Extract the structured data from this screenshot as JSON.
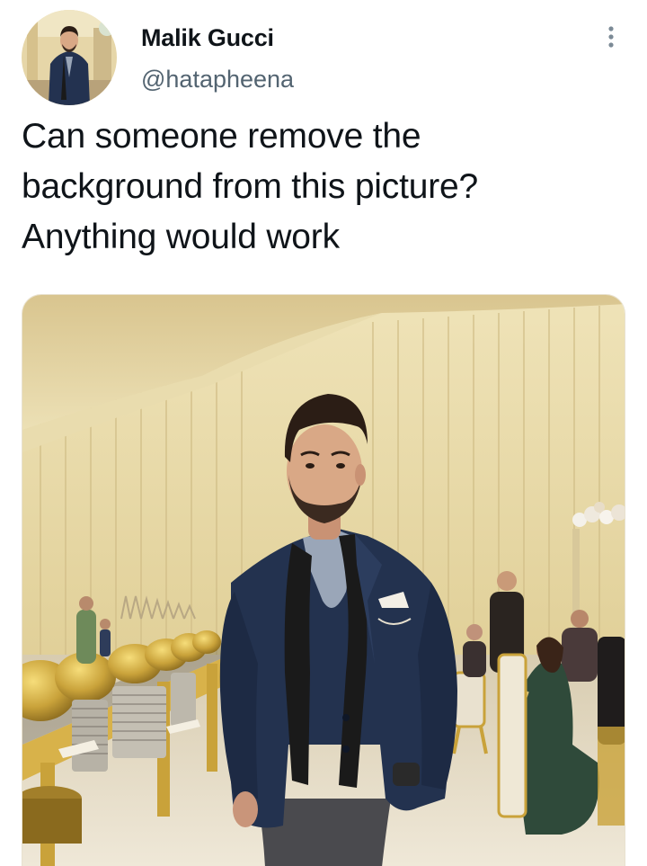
{
  "author": {
    "display_name": "Malik Gucci",
    "handle": "@hatapheena"
  },
  "tweet": {
    "text": "Can someone remove the\nbackground from this picture?\nAnything would work"
  },
  "icons": {
    "more": "more-vertical-icon"
  },
  "colors": {
    "text_primary": "#0f1419",
    "text_secondary": "#536471",
    "drape": "#e8d9a6",
    "suit": "#23324f",
    "gold": "#c9a23a"
  }
}
